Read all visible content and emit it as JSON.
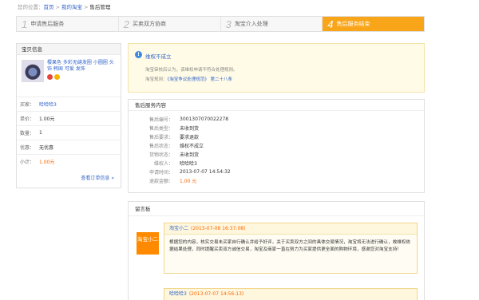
{
  "breadcrumb": {
    "prefix": "您的位置：",
    "items": [
      "首页",
      "我的淘宝",
      "售后管理"
    ],
    "sep": ">"
  },
  "steps": [
    {
      "num": "1",
      "label": "申请售后服务"
    },
    {
      "num": "2",
      "label": "买卖双方协商"
    },
    {
      "num": "3",
      "label": "淘宝介入处理"
    },
    {
      "num": "4",
      "label": "售后服务结束"
    }
  ],
  "product_panel": {
    "title": "宝贝信息",
    "product_title": "樱果色 多彩无缝发圈 小圆圈 头饰 韩国 可爱 发饰",
    "rows": [
      {
        "key": "买家：",
        "value": "哈哈哈3"
      },
      {
        "key": "单价：",
        "value": "1.00元"
      },
      {
        "key": "数量：",
        "value": "1"
      },
      {
        "key": "优惠：",
        "value": "无优惠"
      },
      {
        "key": "小计：",
        "value": "1.00元"
      }
    ],
    "more_link": "查看订单信息 »"
  },
  "status": {
    "title": "维权不成立",
    "desc": "淘宝审核后认为，该维权申请不符合处理规则。",
    "rule_prefix": "淘宝规则：",
    "rule_link": "《淘宝争议处理规范》 第二十八条"
  },
  "detail": {
    "title": "售后服务内容",
    "rows": [
      {
        "key": "售后编号：",
        "value": "3001307070022278"
      },
      {
        "key": "售后类型：",
        "value": "未收到货"
      },
      {
        "key": "售后要求：",
        "value": "要求退款"
      },
      {
        "key": "售后状态：",
        "value": "维权不成立"
      },
      {
        "key": "货物状态：",
        "value": "未收到货"
      },
      {
        "key": "维权人：",
        "value": "哈哈哈3"
      },
      {
        "key": "申请时间：",
        "value": "2013-07-07 14:54:32"
      },
      {
        "key": "退款金额：",
        "value": "1.00 元"
      }
    ]
  },
  "messages": {
    "title": "留言板",
    "avatar_text": "淘宝小二",
    "first": {
      "author": "淘宝小二",
      "time": "(2013-07-08 16:37:08)",
      "body": "根据您的内容，核实交易未买家自行确认并给予好评，关于买卖双方之间的具体交易情况，淘宝将无法进行确认，故维权依据结果处理，同时提醒买卖双方诚信交易，淘宝及商家一直在努力为买家提供更全面的购物环境，感谢您对淘宝支持！"
    },
    "second": {
      "author": "哈哈哈3",
      "time": "(2013-07-07 14:56:13)"
    }
  },
  "colors": {
    "accent": "#f9a51a",
    "link": "#3366cc",
    "price": "#ff6600"
  }
}
